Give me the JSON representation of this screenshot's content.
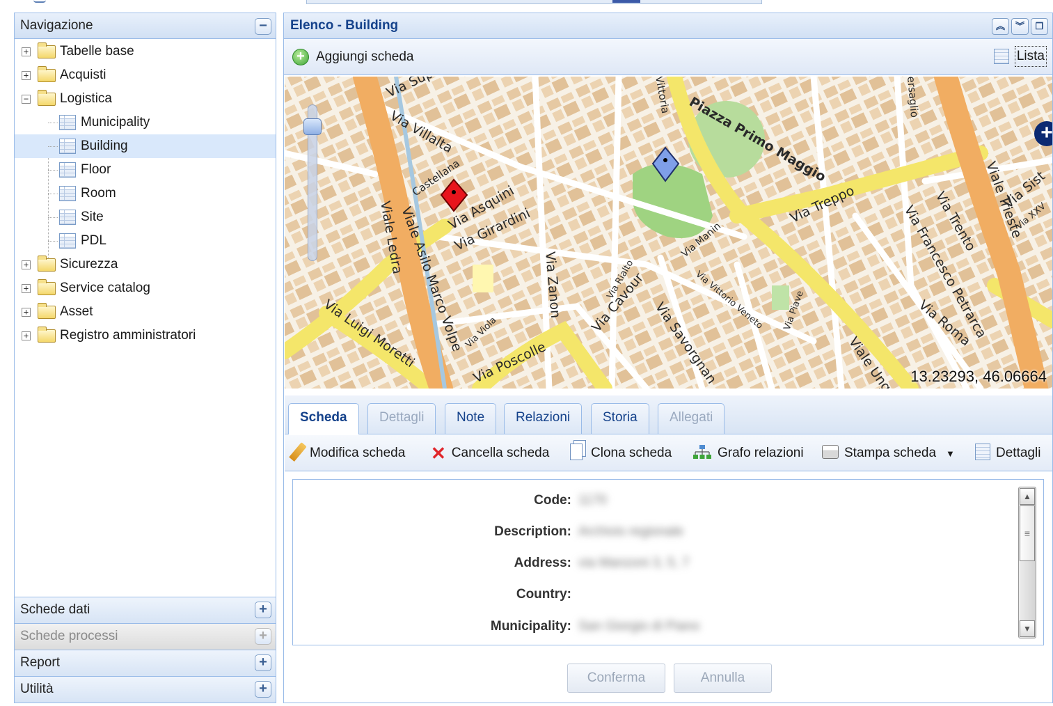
{
  "nav": {
    "title": "Navigazione",
    "collapse_symbol": "−",
    "tree": [
      {
        "label": "Tabelle base",
        "toggle": "+"
      },
      {
        "label": "Acquisti",
        "toggle": "+"
      },
      {
        "label": "Logistica",
        "toggle": "−"
      },
      {
        "label": "Municipality"
      },
      {
        "label": "Building"
      },
      {
        "label": "Floor"
      },
      {
        "label": "Room"
      },
      {
        "label": "Site"
      },
      {
        "label": "PDL"
      },
      {
        "label": "Sicurezza",
        "toggle": "+"
      },
      {
        "label": "Service catalog",
        "toggle": "+"
      },
      {
        "label": "Asset",
        "toggle": "+"
      },
      {
        "label": "Registro amministratori",
        "toggle": "+"
      }
    ],
    "accordion": [
      {
        "label": "Schede dati",
        "symbol": "+"
      },
      {
        "label": "Schede processi",
        "symbol": "+"
      },
      {
        "label": "Report",
        "symbol": "+"
      },
      {
        "label": "Utilità",
        "symbol": "+"
      }
    ]
  },
  "main": {
    "title": "Elenco - Building",
    "add_label": "Aggiungi scheda",
    "lista_label": "Lista",
    "map": {
      "coords": "13.23293, 46.06664",
      "zoom_plus": "+",
      "streets": [
        "Via Sup",
        "Via Villalta",
        "Castellana",
        "Viale Asilo Marco Volpe",
        "Viale Ledra",
        "Via Asquini",
        "Via Girardini",
        "Piazza Primo Maggio",
        "Via Treppo",
        "Via Manin",
        "Via Zanon",
        "Via Rialto",
        "Via Cavour",
        "Via Savorgnan",
        "Via Vittorio Veneto",
        "Via Piave",
        "Viale Trieste",
        "Via Trento",
        "Via Francesco Petrarca",
        "Via Roma",
        "Via Poscolle",
        "Via Luigi Moretti",
        "Via Viola",
        "Viale Ung",
        "Via Sist",
        "Vittoria",
        "ersaglio",
        "Via XXV"
      ]
    },
    "tabs": [
      {
        "label": "Scheda",
        "state": "active"
      },
      {
        "label": "Dettagli",
        "state": "disabled"
      },
      {
        "label": "Note",
        "state": "normal"
      },
      {
        "label": "Relazioni",
        "state": "normal"
      },
      {
        "label": "Storia",
        "state": "normal"
      },
      {
        "label": "Allegati",
        "state": "disabled"
      }
    ],
    "actions": {
      "modifica": "Modifica scheda",
      "cancella": "Cancella scheda",
      "clona": "Clona scheda",
      "grafo": "Grafo relazioni",
      "stampa": "Stampa scheda",
      "dettagli": "Dettagli"
    },
    "form": {
      "fields": [
        {
          "label": "Code:",
          "value": "1170"
        },
        {
          "label": "Description:",
          "value": "Archivio regionale"
        },
        {
          "label": "Address:",
          "value": "via Manzoni 3, 5, 7"
        },
        {
          "label": "Country:",
          "value": ""
        },
        {
          "label": "Municipality:",
          "value": "San Giorgio di Piano"
        }
      ]
    },
    "buttons": {
      "confirm": "Conferma",
      "cancel": "Annulla"
    }
  },
  "colors": {
    "accent": "#15428b",
    "panel_border": "#99bbe8",
    "selected_row": "#d9e8fb",
    "marker_red": "#e8141c",
    "marker_blue": "#7f9fe8"
  }
}
